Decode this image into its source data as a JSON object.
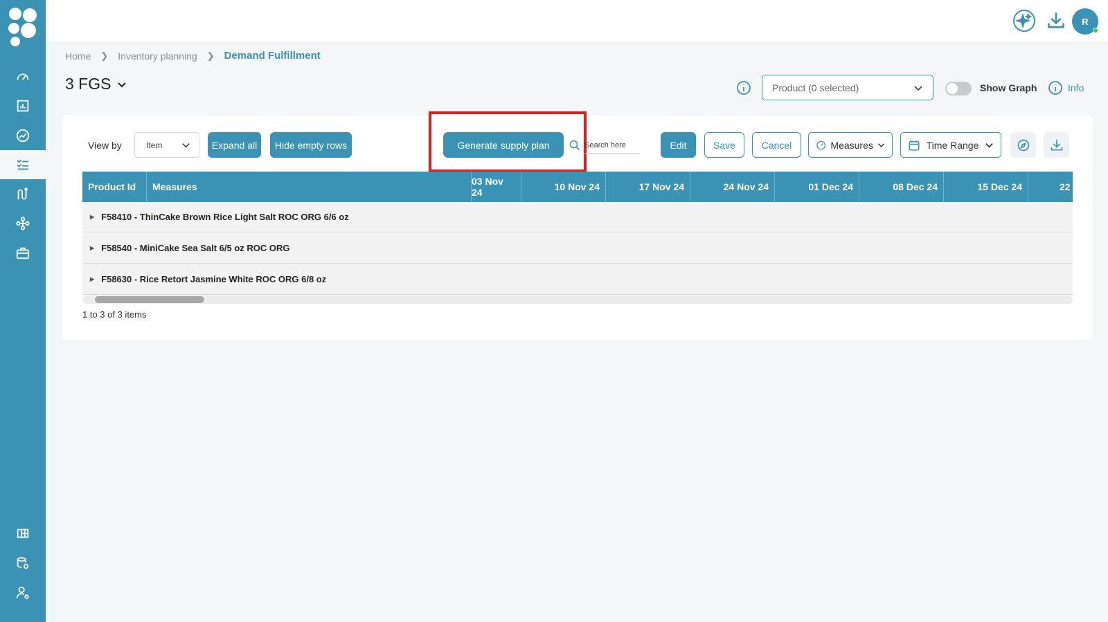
{
  "colors": {
    "accent": "#3a93b4",
    "highlight": "#e01e1e",
    "online": "#2ecc40"
  },
  "sidebar": {
    "icons": [
      "speedometer-icon",
      "bar-chart-icon",
      "trend-chart-icon",
      "checklist-icon",
      "route-icon",
      "network-icon",
      "briefcase-icon",
      "dashboard-grid-icon",
      "database-settings-icon",
      "user-settings-icon"
    ]
  },
  "topbar": {
    "avatar_initial": "R"
  },
  "breadcrumb": {
    "home": "Home",
    "section": "Inventory planning",
    "current": "Demand Fulfillment"
  },
  "page": {
    "title": "3 FGS"
  },
  "filters": {
    "product_label": "Product (0 selected)",
    "show_graph": "Show Graph",
    "info": "Info"
  },
  "toolbar": {
    "view_by_label": "View by",
    "view_by_value": "Item",
    "expand_all": "Expand all",
    "hide_empty_rows": "Hide empty rows",
    "generate_supply_plan": "Generate supply plan",
    "search_placeholder": "Search here",
    "edit": "Edit",
    "save": "Save",
    "cancel": "Cancel",
    "measures": "Measures",
    "time_range": "Time Range"
  },
  "grid": {
    "col_product_id": "Product Id",
    "col_measures": "Measures",
    "dates": [
      "03 Nov 24",
      "10 Nov 24",
      "17 Nov 24",
      "24 Nov 24",
      "01 Dec 24",
      "08 Dec 24",
      "15 Dec 24",
      "22"
    ],
    "rows": [
      "F58410 - ThinCake Brown Rice Light Salt ROC ORG 6/6 oz",
      "F58540 - MiniCake Sea Salt 6/5 oz ROC ORG",
      "F58630 - Rice Retort Jasmine White ROC ORG 6/8 oz"
    ],
    "pager": "1 to 3 of 3 items"
  }
}
